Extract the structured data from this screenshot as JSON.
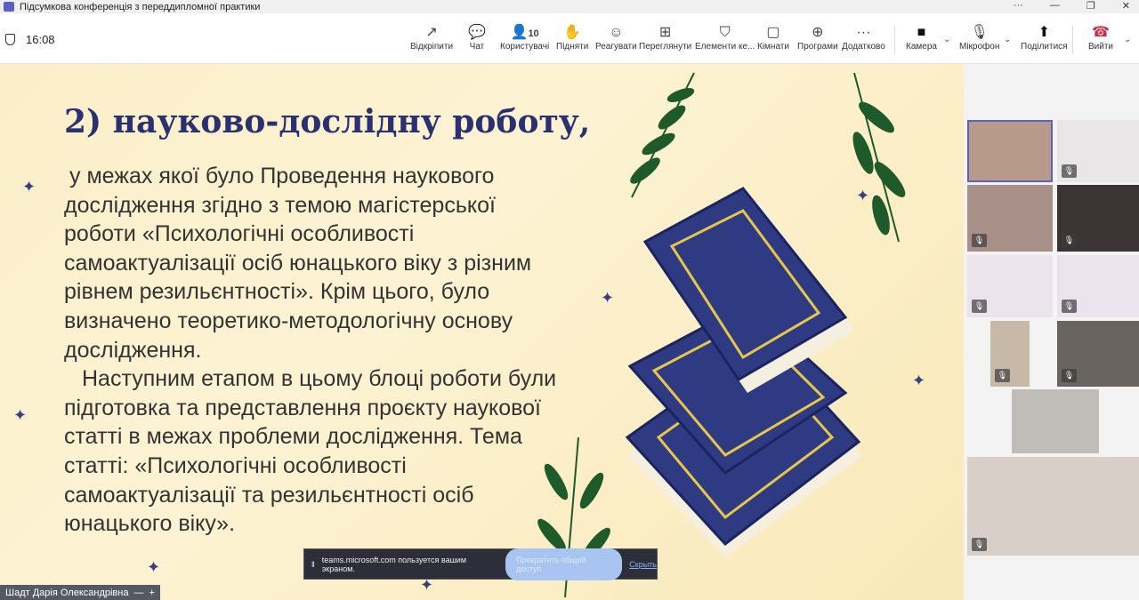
{
  "window": {
    "title": "Підсумкова конференція з переддипломної практики",
    "controls": [
      "···",
      "—",
      "❐",
      "✕"
    ]
  },
  "meeting": {
    "time": "16:08",
    "participants_count": "10"
  },
  "toolbar": [
    {
      "label": "Відкріпити",
      "icon": "↗"
    },
    {
      "label": "Чат",
      "icon": "💬"
    },
    {
      "label": "Користувачі",
      "icon": "👤"
    },
    {
      "label": "Підняти",
      "icon": "✋"
    },
    {
      "label": "Реагувати",
      "icon": "☺"
    },
    {
      "label": "Переглянути",
      "icon": "⊞"
    },
    {
      "label": "Елементи ке...",
      "icon": "⛉"
    },
    {
      "label": "Кімнати",
      "icon": "▢"
    },
    {
      "label": "Програми",
      "icon": "⊕"
    },
    {
      "label": "Додатково",
      "icon": "···"
    },
    {
      "label": "Камера",
      "icon": "■"
    },
    {
      "label": "Мікрофон",
      "icon": "🎙"
    },
    {
      "label": "Поділитися",
      "icon": "⬆"
    },
    {
      "label": "Вийти",
      "icon": "☎"
    }
  ],
  "slide": {
    "heading_num": "2)",
    "heading": "науково-дослідну роботу,",
    "p1": "у межах якої було Проведення наукового дослідження згідно з темою магістерської роботи «Психологічні особливості самоактуалізації осіб юнацького віку з різним рівнем резильєнтності». Крім цього, було визначено теоретико-методологічну основу дослідження.",
    "p2": "Наступним етапом в цьому блоці роботи були підготовка та представлення проєкту наукової статті в межах проблеми дослідження. Тема статті: «Психологічні особливості самоактуалізації та резильєнтності осіб юнацького віку»."
  },
  "share_banner": {
    "text": "teams.microsoft.com пользуется вашим экраном.",
    "stop": "Прекратить общий доступ",
    "hide": "Скрыть"
  },
  "presenter": {
    "name": "Шадт Дарія Олександрівна"
  },
  "colors": {
    "accent": "#5b5fc7",
    "leave": "#c4314b",
    "heading": "#2b3170",
    "book": "#2e3a82"
  }
}
